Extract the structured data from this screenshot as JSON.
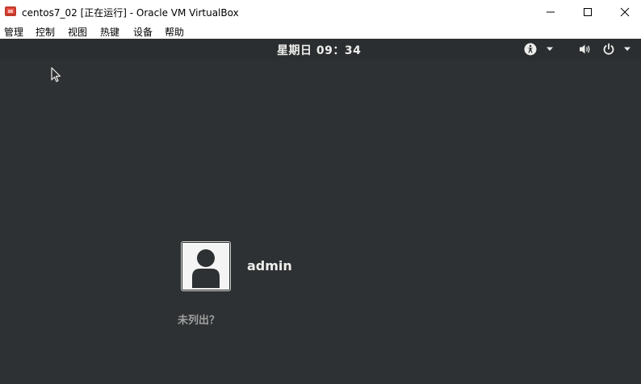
{
  "window": {
    "title": "centos7_02 [正在运行] - Oracle VM VirtualBox",
    "icon": "virtualbox-icon",
    "controls": [
      "minimize-icon",
      "maximize-icon",
      "close-icon"
    ]
  },
  "menubar": {
    "items": [
      "管理",
      "控制",
      "视图",
      "热键",
      "设备",
      "帮助"
    ]
  },
  "vm": {
    "topbar": {
      "clock": "星期日 09：34",
      "icons": [
        "accessibility-icon",
        "chevron-down-icon",
        "volume-icon",
        "power-icon",
        "chevron-down-icon"
      ]
    },
    "login": {
      "username": "admin",
      "not_listed": "未列出？"
    }
  },
  "colors": {
    "screen_bg": "#2e3133",
    "text_light": "#eeeeec",
    "text_dim": "#a0a0a0"
  }
}
